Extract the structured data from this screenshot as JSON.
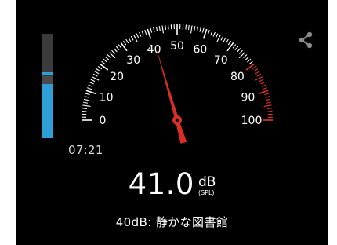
{
  "meter": {
    "unit": "dB",
    "unit_qualifier": "(SPL)",
    "value": 41.0,
    "value_text": "41.0",
    "description": "40dB: 静かな図書館",
    "elapsed_time": "07:21"
  },
  "gauge": {
    "min": 0,
    "max": 100,
    "labels": [
      "0",
      "10",
      "20",
      "30",
      "40",
      "50",
      "60",
      "70",
      "80",
      "90",
      "100"
    ],
    "warning_from": 80,
    "needle_value": 41.0
  },
  "level_bar": {
    "fill_fraction": 0.52,
    "peak_fraction": 0.53
  },
  "share_icon": "share-icon",
  "colors": {
    "background": "#000000",
    "tick_normal": "#ffffff",
    "tick_warning": "#e0342c",
    "needle": "#d92e24",
    "level_fill": "#2f9fd8",
    "level_track": "#3b3b3b"
  }
}
